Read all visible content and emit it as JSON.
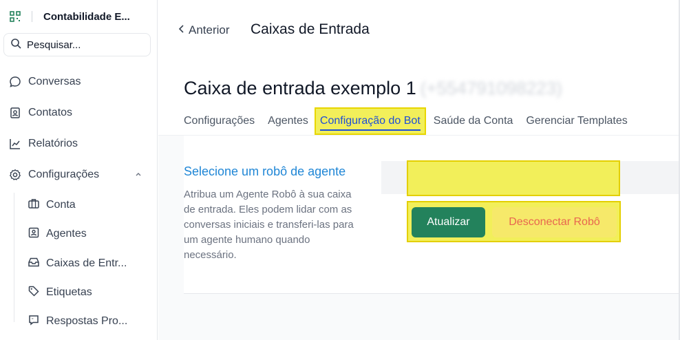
{
  "brand": {
    "name": "Contabilidade E..."
  },
  "search": {
    "label": "Pesquisar..."
  },
  "nav": {
    "items": [
      {
        "label": "Conversas",
        "icon": "chat-bubble-icon"
      },
      {
        "label": "Contatos",
        "icon": "contact-card-icon"
      },
      {
        "label": "Relatórios",
        "icon": "line-chart-icon"
      },
      {
        "label": "Configurações",
        "icon": "settings-icon"
      }
    ],
    "settings_sub": [
      {
        "label": "Conta",
        "icon": "briefcase-icon"
      },
      {
        "label": "Agentes",
        "icon": "agent-card-icon"
      },
      {
        "label": "Caixas de Entr...",
        "icon": "inbox-icon"
      },
      {
        "label": "Etiquetas",
        "icon": "tag-icon"
      },
      {
        "label": "Respostas Pro...",
        "icon": "quick-reply-icon"
      }
    ]
  },
  "header": {
    "back_label": "Anterior",
    "title": "Caixas de Entrada"
  },
  "inbox": {
    "name": "Caixa de entrada exemplo 1",
    "phone": "(+554791098223)"
  },
  "tabs": [
    {
      "label": "Configurações"
    },
    {
      "label": "Agentes"
    },
    {
      "label": "Configuração do Bot",
      "active": true
    },
    {
      "label": "Saúde da Conta"
    },
    {
      "label": "Gerenciar Templates"
    }
  ],
  "bot_section": {
    "heading": "Selecione um robô de agente",
    "description": "Atribua um Agente Robô à sua caixa de entrada. Eles podem lidar com as conversas iniciais e transferi-las para um agente humano quando necessário.",
    "select_value": "",
    "update_label": "Atualizar",
    "disconnect_label": "Desconectar Robô"
  },
  "colors": {
    "accent_link": "#1f86d6",
    "primary_button": "#23825c",
    "danger_text": "#e8664f",
    "highlight": "#f2ef5a"
  }
}
